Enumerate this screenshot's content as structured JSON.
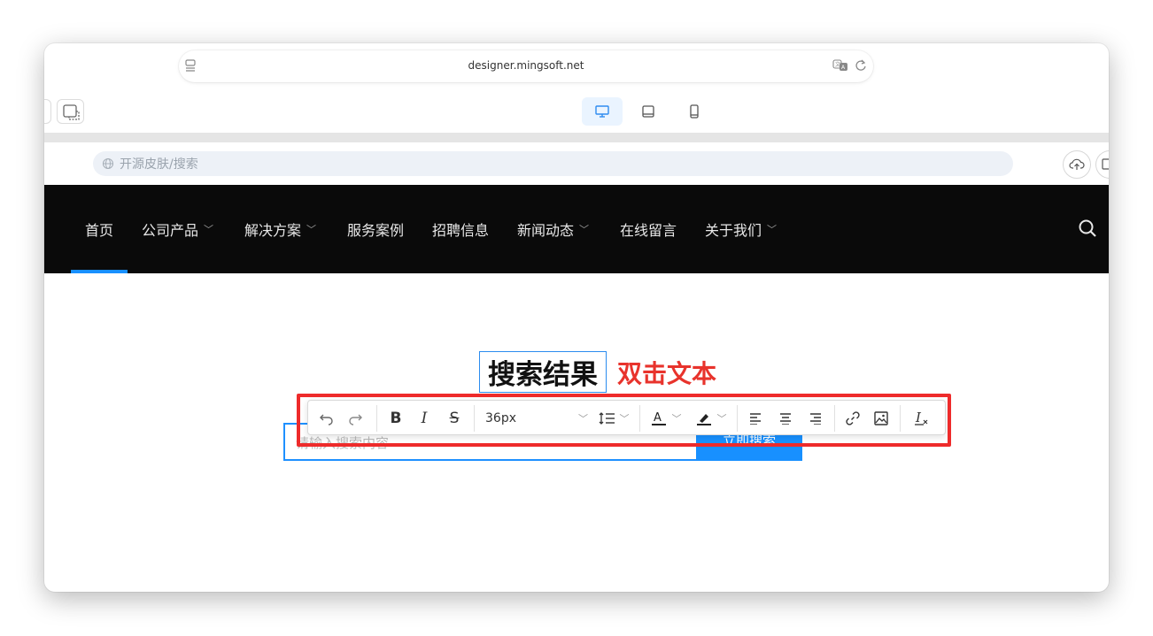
{
  "browser": {
    "url": "designer.mingsoft.net"
  },
  "breadcrumb": {
    "text": "开源皮肤/搜索"
  },
  "nav": {
    "items": [
      {
        "label": "首页",
        "dropdown": false
      },
      {
        "label": "公司产品",
        "dropdown": true
      },
      {
        "label": "解决方案",
        "dropdown": true
      },
      {
        "label": "服务案例",
        "dropdown": false
      },
      {
        "label": "招聘信息",
        "dropdown": false
      },
      {
        "label": "新闻动态",
        "dropdown": true
      },
      {
        "label": "在线留言",
        "dropdown": false
      },
      {
        "label": "关于我们",
        "dropdown": true
      }
    ],
    "active_index": 0
  },
  "content": {
    "title": "搜索结果",
    "hint": "双击文本",
    "search_placeholder": "请输入搜索内容",
    "search_button": "立即搜索"
  },
  "toolbar": {
    "font_size": "36px"
  },
  "colors": {
    "accent": "#1890ff",
    "nav_bg": "#0a0a0a",
    "highlight_red": "#ee2b2b"
  }
}
